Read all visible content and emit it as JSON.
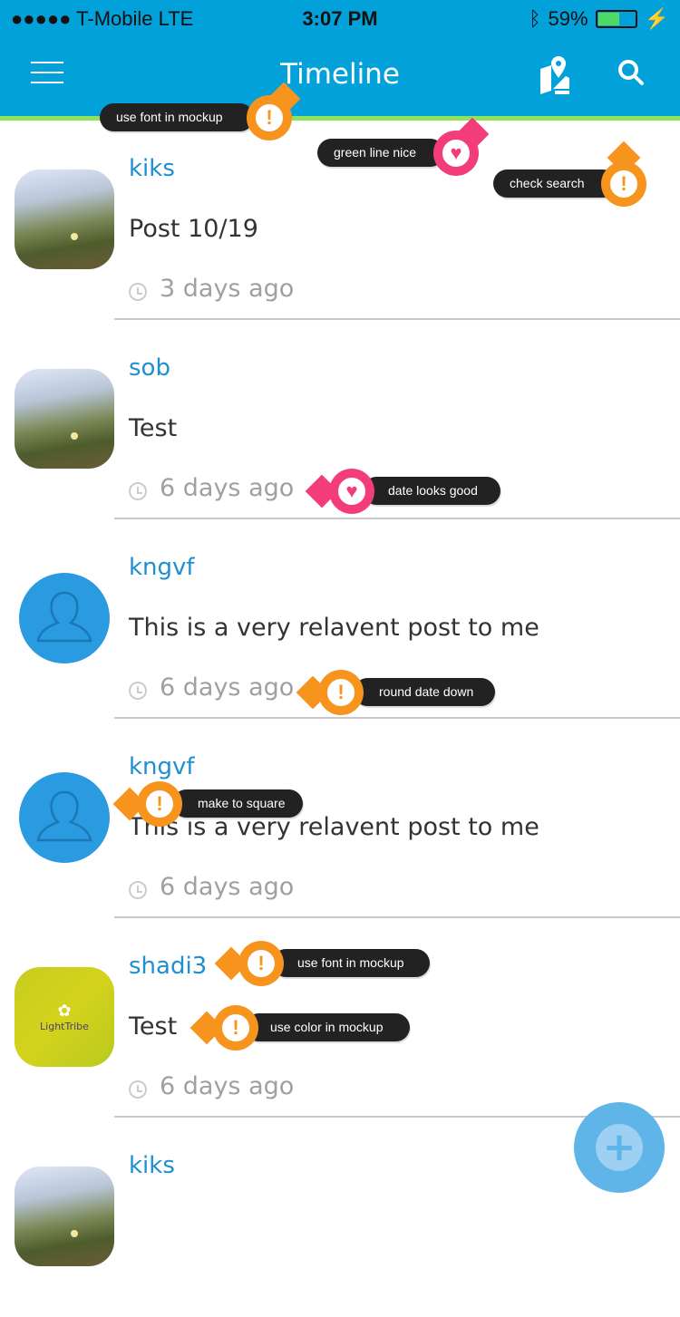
{
  "status": {
    "carrier": "●●●●● T-Mobile  LTE",
    "time": "3:07 PM",
    "battery": "59%",
    "battery_level": 0.59
  },
  "header": {
    "title": "Timeline",
    "icons": [
      "menu-icon",
      "map-icon",
      "search-icon"
    ]
  },
  "posts": [
    {
      "user": "kiks",
      "text": "Post 10/19",
      "time": "3 days ago",
      "avatar": "photo"
    },
    {
      "user": "sob",
      "text": "Test",
      "time": "6 days ago",
      "avatar": "photo"
    },
    {
      "user": "kngvf",
      "text": "This is a very relavent post to me",
      "time": "6 days ago",
      "avatar": "default-user"
    },
    {
      "user": "kngvf",
      "text": "This is a very relavent post to me",
      "time": "6 days ago",
      "avatar": "default-user"
    },
    {
      "user": "shadi3",
      "text": "Test",
      "time": "6 days ago",
      "avatar": "logo",
      "logo_text": "LightTribe"
    },
    {
      "user": "kiks",
      "text": "",
      "time": "",
      "avatar": "photo"
    }
  ],
  "annotations": [
    {
      "label": "use font in mockup",
      "type": "warning"
    },
    {
      "label": "green line nice",
      "type": "like"
    },
    {
      "label": "check search",
      "type": "warning"
    },
    {
      "label": "date looks good",
      "type": "like"
    },
    {
      "label": "round date down",
      "type": "warning"
    },
    {
      "label": "make to square",
      "type": "warning"
    },
    {
      "label": "use font in mockup",
      "type": "warning"
    },
    {
      "label": "use color in mockup",
      "type": "warning"
    }
  ],
  "fab": {
    "label": "+"
  },
  "colors": {
    "header": "#02a1d9",
    "accent_line": "#8ee35a",
    "username": "#1e90d2",
    "warning": "#f7941d",
    "like": "#f23d7a"
  }
}
